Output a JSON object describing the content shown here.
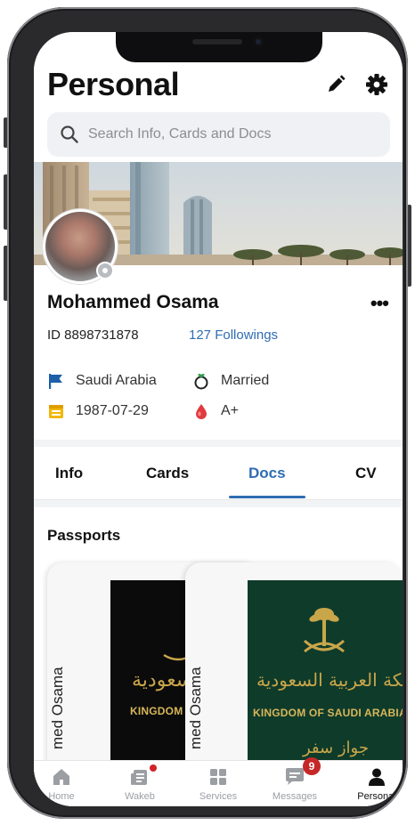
{
  "header": {
    "title": "Personal",
    "search_placeholder": "Search Info, Cards and Docs"
  },
  "profile": {
    "name": "Mohammed Osama",
    "id_text": "ID 8898731878",
    "followings": "127 Followings",
    "country": "Saudi Arabia",
    "marital_status": "Married",
    "birth_date": "1987-07-29",
    "blood_type": "A+"
  },
  "tabs": [
    {
      "label": "Info"
    },
    {
      "label": "Cards"
    },
    {
      "label": "Docs",
      "active": true
    },
    {
      "label": "CV"
    }
  ],
  "docs": {
    "section_title": "Passports",
    "cards": [
      {
        "holder_name": "med Osama",
        "kingdom_text": "KINGDOM O",
        "arabic_text": "لسعودية",
        "cover_color": "#0b0b0b"
      },
      {
        "holder_name": "med Osama",
        "kingdom_text": "KINGDOM OF SAUDI ARABIA",
        "arabic_text": "المملكة العربية السعودية",
        "type_text": "جواز سفر",
        "cover_color": "#0f3b2a"
      }
    ]
  },
  "bottom_nav": {
    "items": [
      {
        "label": "Home",
        "icon": "home-icon"
      },
      {
        "label": "Wakeb",
        "icon": "news-icon",
        "has_dot": true
      },
      {
        "label": "Services",
        "icon": "grid-icon"
      },
      {
        "label": "Messages",
        "icon": "chat-icon",
        "badge": "9"
      },
      {
        "label": "Personal",
        "icon": "person-icon",
        "active": true
      }
    ]
  },
  "colors": {
    "accent": "#2f6db3",
    "badge": "#c62828",
    "passport_gold": "#c9a64a"
  }
}
